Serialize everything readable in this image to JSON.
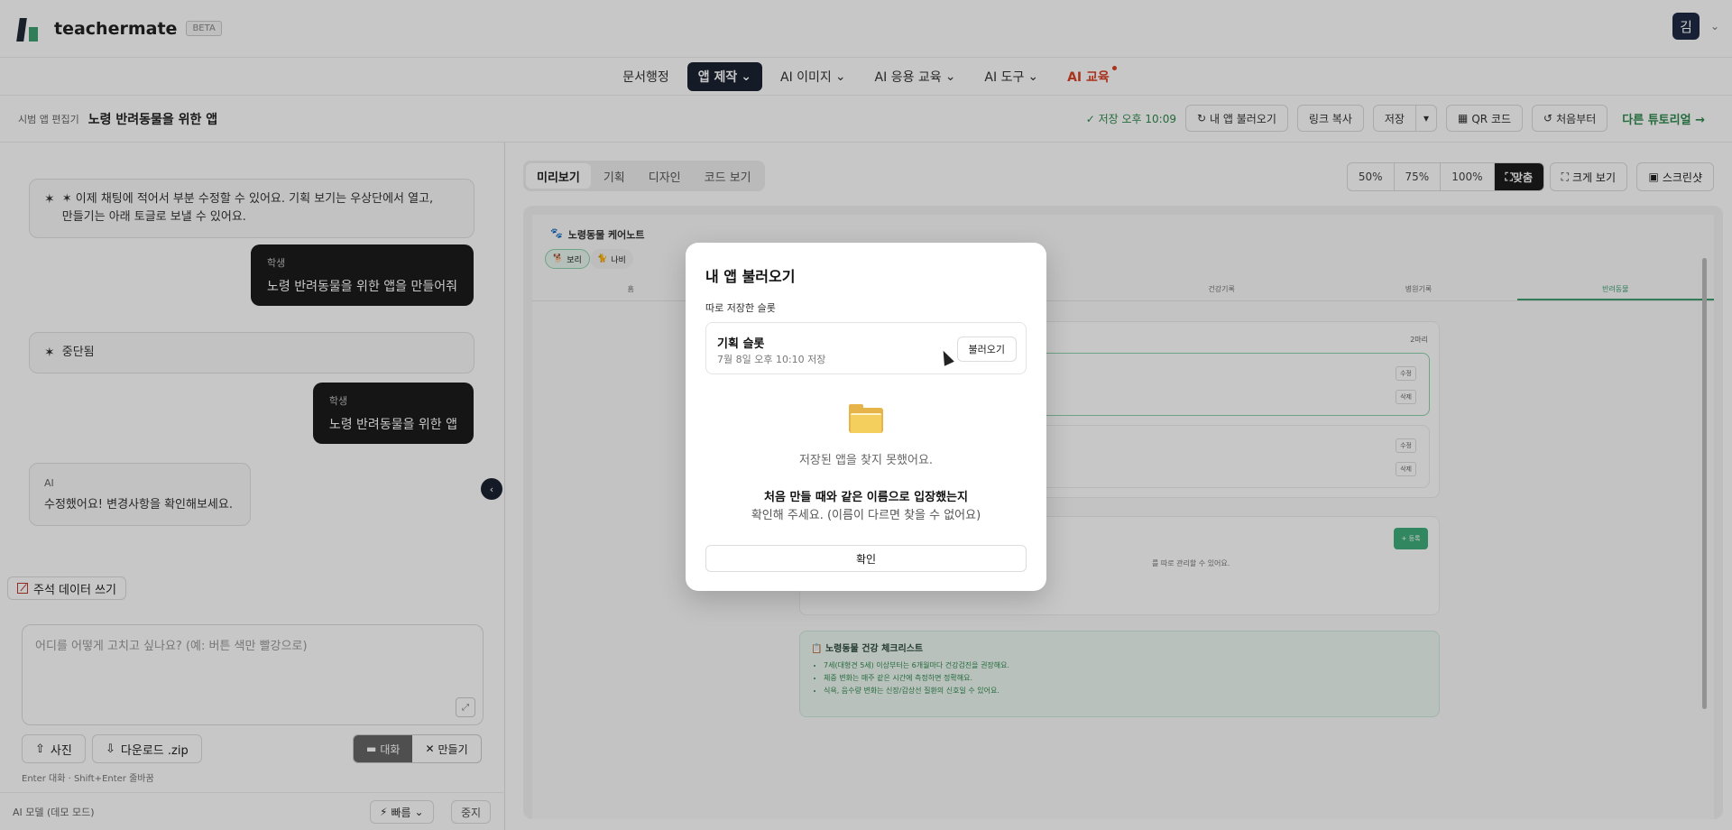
{
  "header": {
    "brand": "teachermate",
    "beta": "BETA",
    "user_initial": "김"
  },
  "nav": {
    "items": [
      {
        "label": "문서행정"
      },
      {
        "label": "앱 제작",
        "active": true,
        "chevron": true
      },
      {
        "label": "AI 이미지",
        "chevron": true
      },
      {
        "label": "AI 응용 교육",
        "chevron": true
      },
      {
        "label": "AI 도구",
        "chevron": true
      },
      {
        "label": "AI 교육",
        "accent": "#d94226"
      }
    ]
  },
  "toolbar": {
    "editor_label": "시범 앱 편집기",
    "app_title": "노령 반려동물을 위한 앱",
    "saved": "✓ 저장 오후 10:09",
    "load_my_app": "내 앱 불러오기",
    "copy_link": "링크 복사",
    "save": "저장",
    "qr": "QR 코드",
    "restart": "처음부터",
    "tutorial": "다른 튜토리얼 →"
  },
  "chat": {
    "ai_msg1": "이제 채팅에 적어서 부분 수정할 수 있어요. 기획 보기는 우상단에서 열고,",
    "ai_msg1b": "만들기는 아래 토글로 보낼 수 있어요.",
    "user_label": "학생",
    "user_msg1": "노령 반려동물을 위한 앱을 만들어줘",
    "stopped": "중단됨",
    "user_msg2": "노령 반려동물을 위한 앱",
    "ai_label": "AI",
    "ai_msg2": "수정했어요! 변경사항을 확인해보세요.",
    "annotate": "주석 데이터 쓰기",
    "placeholder": "어디를 어떻게 고치고 싶나요? (예: 버튼 색만 빨강으로)",
    "photo": "사진",
    "download": "다운로드 .zip",
    "mode_chat": "대화",
    "mode_build": "만들기",
    "hint": "Enter 대화 · Shift+Enter 줄바꿈",
    "model": "AI 모델 (데모 모드)",
    "speed": "빠름",
    "stop": "중지"
  },
  "preview": {
    "tabs": [
      {
        "label": "미리보기",
        "active": true
      },
      {
        "label": "기획"
      },
      {
        "label": "디자인"
      },
      {
        "label": "코드 보기"
      }
    ],
    "zoom": [
      "50%",
      "75%",
      "100%",
      "맞춤"
    ],
    "fullscreen": "크게 보기",
    "screenshot": "스크린샷",
    "app_name": "노령동물 케어노트",
    "pet1": "보리",
    "pet2": "나비",
    "app_tabs": [
      "홈",
      "",
      "",
      "건강기록",
      "병원기록",
      "반려동물"
    ],
    "count": "2마리",
    "edit": "수정",
    "delete": "삭제",
    "add": "+ 등록",
    "manage_note": "를 따로 관리할 수 있어요.",
    "checklist_title": "노령동물 건강 체크리스트",
    "checklist": [
      "7세(대형견 5세) 이상부터는 6개월마다 건강검진을 권장해요.",
      "체중 변화는 매주 같은 시간에 측정하면 정확해요.",
      "식욕, 음수량 변화는 신장/갑상선 질환의 신호일 수 있어요."
    ]
  },
  "modal": {
    "title": "내 앱 불러오기",
    "section": "따로 저장한 슬롯",
    "slot_name": "기획 슬롯",
    "slot_date": "7월 8일 오후 10:10 저장",
    "load": "불러오기",
    "empty": "저장된 앱을 찾지 못했어요.",
    "strong": "처음 만들 때와 같은 이름으로 입장했는지",
    "note": "확인해 주세요. (이름이 다르면 찾을 수 없어요)",
    "confirm": "확인"
  }
}
